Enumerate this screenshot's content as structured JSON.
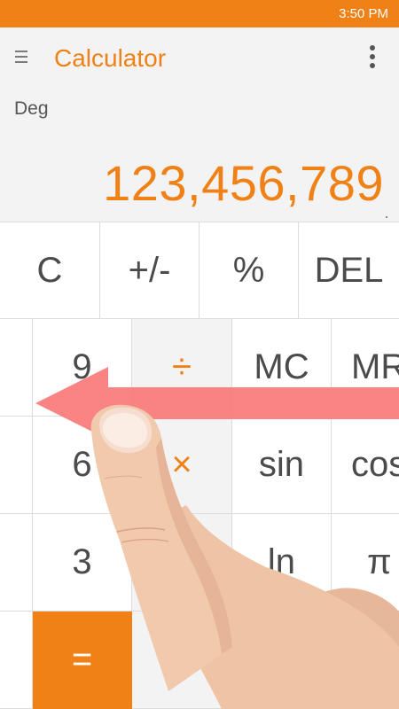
{
  "status_bar": {
    "time": "3:50 PM"
  },
  "app_bar": {
    "title": "Calculator",
    "menu_icon": "hamburger-menu-icon",
    "more_icon": "more-vertical-icon"
  },
  "display": {
    "mode": "Deg",
    "value": "123,456,789"
  },
  "keys": {
    "row1": [
      "C",
      "+/-",
      "%",
      "DEL"
    ],
    "row2": [
      "9",
      "÷",
      "MC",
      "MR"
    ],
    "row3": [
      "6",
      "×",
      "sin",
      "cos"
    ],
    "row4": [
      "3",
      "",
      "ln",
      "π"
    ],
    "row5": [
      "="
    ]
  },
  "overlay": {
    "gesture": "swipe-left-arrow",
    "hand": "pointing-finger"
  },
  "colors": {
    "accent": "#ef8116",
    "panel": "#f3f3f3",
    "key_text": "#4b4b4b",
    "arrow": "#fa7a7a"
  }
}
